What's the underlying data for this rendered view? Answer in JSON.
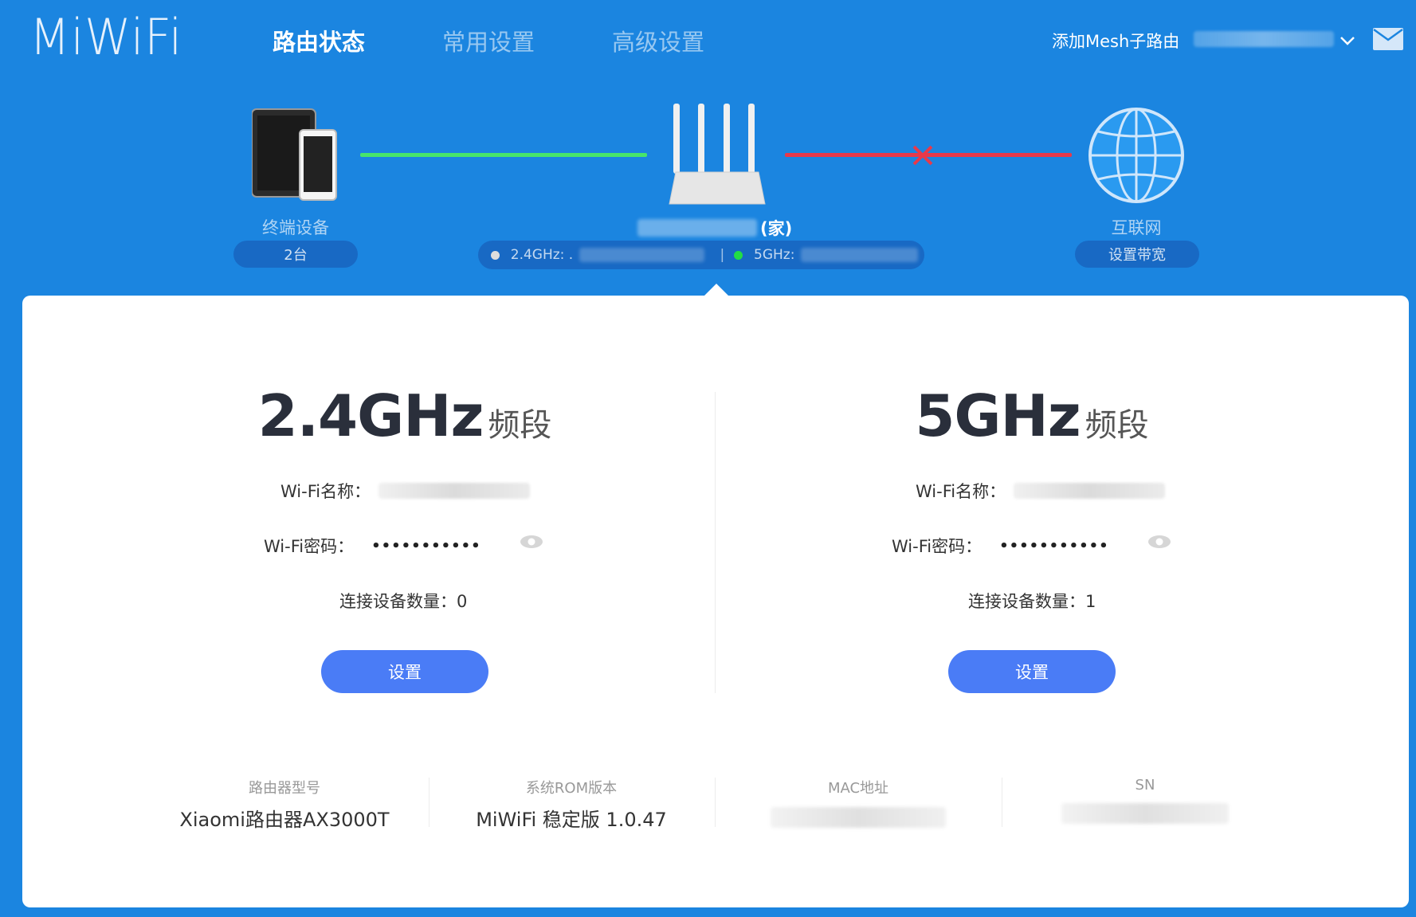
{
  "header": {
    "logo": "MiWiFi",
    "nav": [
      {
        "label": "路由状态",
        "active": true
      },
      {
        "label": "常用设置",
        "active": false
      },
      {
        "label": "高级设置",
        "active": false
      }
    ],
    "mesh_link": "添加Mesh子路由"
  },
  "topology": {
    "devices_label": "终端设备",
    "devices_count": "2台",
    "router_tag": "(家)",
    "band_24_label": "2.4GHz: .",
    "band_24_status_color": "#dddddd",
    "band_5_label": "5GHz:",
    "band_5_status_color": "#22dd44",
    "separator": "|",
    "internet_label": "互联网",
    "internet_button": "设置带宽",
    "link_left_color": "#47e56b",
    "link_right_color": "#e8394a"
  },
  "bands": [
    {
      "title": "2.4GHz",
      "suffix": "频段",
      "name_label": "Wi-Fi名称：",
      "password_label": "Wi-Fi密码：",
      "password": "•••••••••••",
      "connected_label": "连接设备数量：0",
      "button": "设置"
    },
    {
      "title": "5GHz",
      "suffix": "频段",
      "name_label": "Wi-Fi名称：",
      "password_label": "Wi-Fi密码：",
      "password": "•••••••••••",
      "connected_label": "连接设备数量：1",
      "button": "设置"
    }
  ],
  "info": [
    {
      "key": "路由器型号",
      "value": "Xiaomi路由器AX3000T"
    },
    {
      "key": "系统ROM版本",
      "value": "MiWiFi 稳定版 1.0.47"
    },
    {
      "key": "MAC地址",
      "value": ""
    },
    {
      "key": "SN",
      "value": ""
    }
  ],
  "colors": {
    "header_bg": "#1b85e0",
    "accent_button": "#4a7cf6"
  }
}
